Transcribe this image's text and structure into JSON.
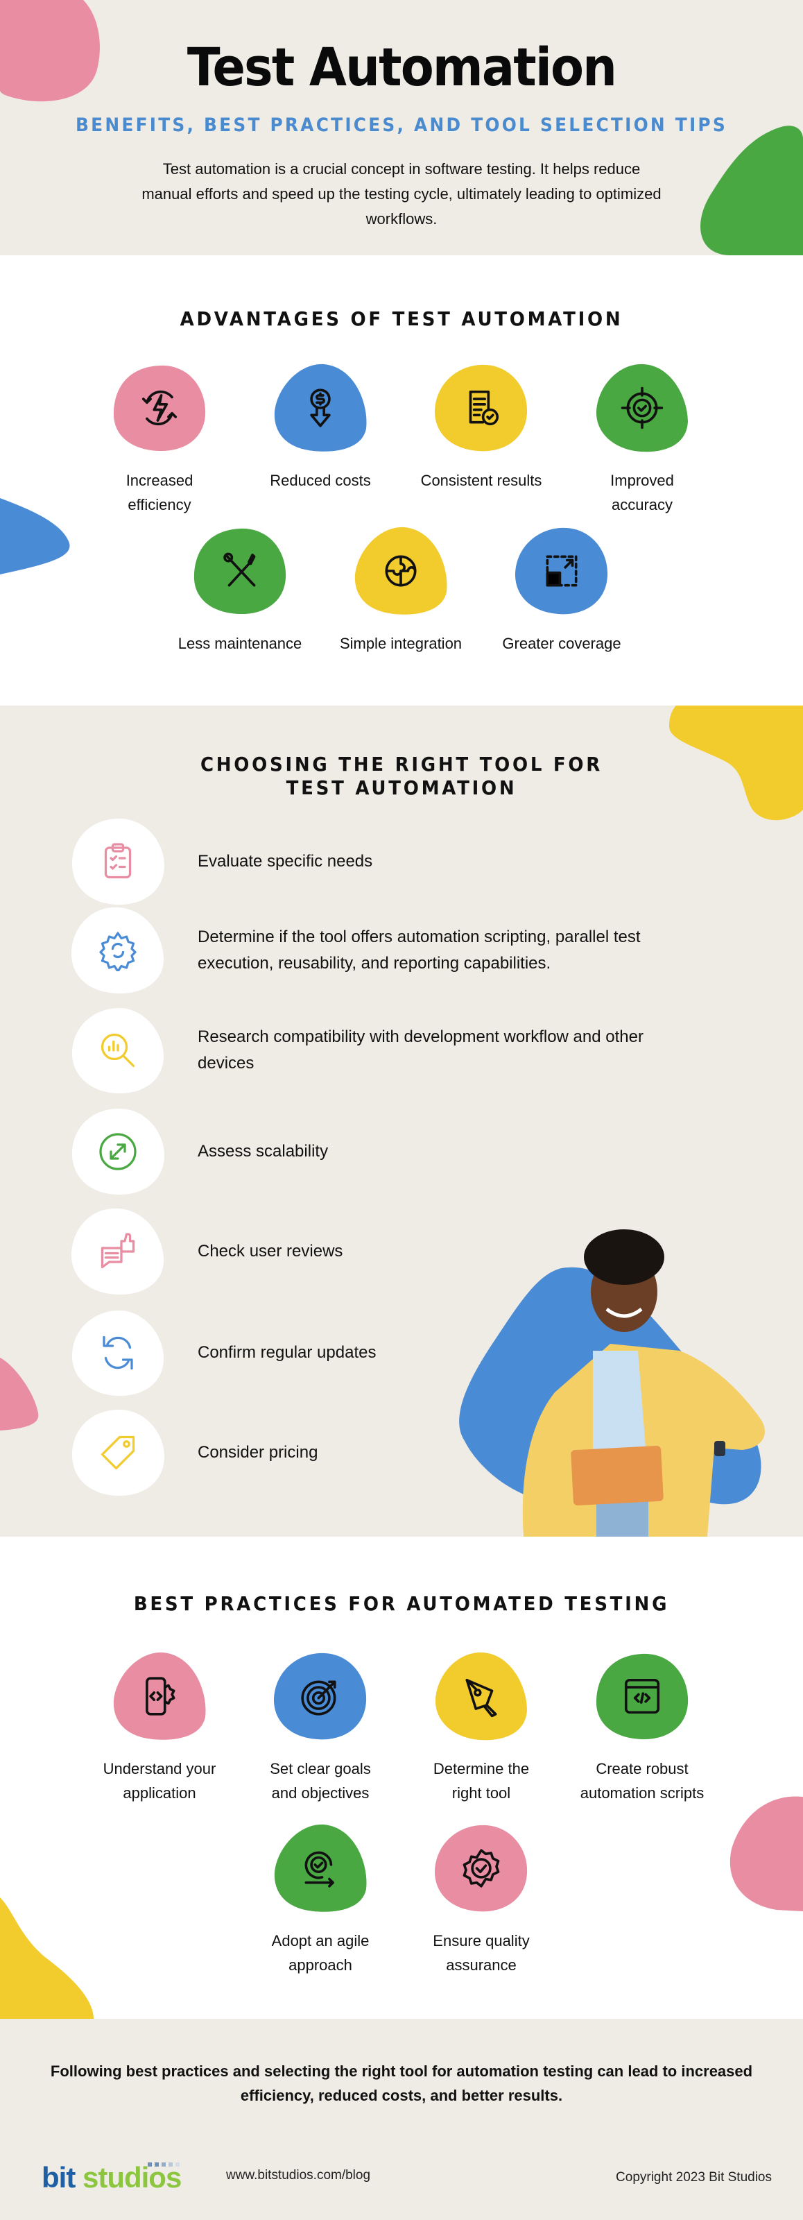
{
  "colors": {
    "beige": "#efece6",
    "pink": "#e88da2",
    "blue": "#4a8bd6",
    "yellow": "#f2cb2c",
    "green": "#4aa843",
    "subtitle_blue": "#4a8bd0",
    "logo_blue": "#1f5fa3",
    "logo_green": "#8cc63f"
  },
  "hero": {
    "title": "Test Automation",
    "subtitle": "BENEFITS, BEST PRACTICES, AND TOOL SELECTION TIPS",
    "intro": "Test automation is a crucial concept in software testing. It helps reduce manual efforts and speed up the testing cycle, ultimately leading to optimized workflows."
  },
  "advantages": {
    "heading": "ADVANTAGES OF TEST AUTOMATION",
    "items": [
      {
        "label": "Increased efficiency",
        "icon": "efficiency-cycle-bolt-icon",
        "color": "pink"
      },
      {
        "label": "Reduced costs",
        "icon": "dollar-down-arrow-icon",
        "color": "blue"
      },
      {
        "label": "Consistent results",
        "icon": "document-check-icon",
        "color": "yellow"
      },
      {
        "label": "Improved accuracy",
        "icon": "target-check-icon",
        "color": "green"
      },
      {
        "label": "Less maintenance",
        "icon": "wrench-screwdriver-icon",
        "color": "green"
      },
      {
        "label": "Simple integration",
        "icon": "puzzle-globe-icon",
        "color": "yellow"
      },
      {
        "label": "Greater coverage",
        "icon": "expand-square-icon",
        "color": "blue"
      }
    ]
  },
  "tools": {
    "heading": "CHOOSING THE RIGHT TOOL FOR TEST AUTOMATION",
    "items": [
      {
        "text": "Evaluate specific needs",
        "icon": "clipboard-checklist-icon",
        "color": "pink"
      },
      {
        "text": "Determine if the tool offers automation scripting, parallel test execution, reusability, and reporting capabilities.",
        "icon": "gear-sync-icon",
        "color": "blue"
      },
      {
        "text": "Research compatibility with development workflow and other devices",
        "icon": "search-analytics-icon",
        "color": "yellow"
      },
      {
        "text": "Assess scalability",
        "icon": "resize-diagonal-icon",
        "color": "green"
      },
      {
        "text": "Check user reviews",
        "icon": "review-thumbs-up-icon",
        "color": "pink"
      },
      {
        "text": "Confirm regular updates",
        "icon": "refresh-icon",
        "color": "blue"
      },
      {
        "text": "Consider pricing",
        "icon": "price-tag-icon",
        "color": "yellow"
      }
    ]
  },
  "practices": {
    "heading": "BEST PRACTICES FOR AUTOMATED TESTING",
    "items": [
      {
        "label": "Understand your application",
        "icon": "mobile-code-gear-icon",
        "color": "pink"
      },
      {
        "label": "Set clear goals and objectives",
        "icon": "target-arrow-icon",
        "color": "blue"
      },
      {
        "label": "Determine the right tool",
        "icon": "pen-nib-icon",
        "color": "yellow"
      },
      {
        "label": "Create robust automation scripts",
        "icon": "browser-code-icon",
        "color": "green"
      },
      {
        "label": "Adopt an agile approach",
        "icon": "agile-cycle-check-icon",
        "color": "green"
      },
      {
        "label": "Ensure quality assurance",
        "icon": "quality-badge-icon",
        "color": "pink"
      }
    ]
  },
  "footer": {
    "closing": "Following best practices and selecting the right tool for automation testing can lead to increased efficiency, reduced costs, and better results.",
    "logo_bit": "bit",
    "logo_studios": "studios",
    "site": "www.bitstudios.com/blog",
    "copyright": "Copyright 2023 Bit Studios"
  }
}
